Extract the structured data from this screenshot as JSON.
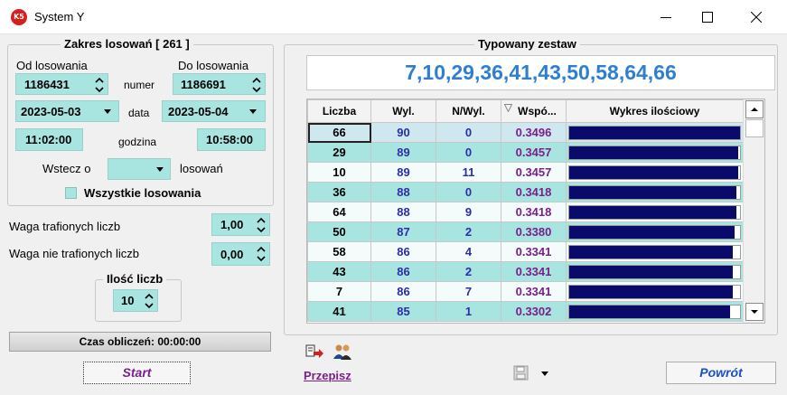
{
  "window": {
    "title": "System Y",
    "icon_text": "K5",
    "minimize_icon": "minimize-icon",
    "maximize_icon": "maximize-icon",
    "close_icon": "close-icon"
  },
  "range": {
    "title": "Zakres losowań  [ 261 ]",
    "from_label": "Od losowania",
    "to_label": "Do losowania",
    "from_number": "1186431",
    "to_number": "1186691",
    "number_label": "numer",
    "from_date": "2023-05-03",
    "to_date": "2023-05-04",
    "date_label": "data",
    "from_time": "11:02:00",
    "to_time": "10:58:00",
    "time_label": "godzina",
    "back_label": "Wstecz o",
    "back_value": "",
    "draws_label": "losowań",
    "all_draws_label": "Wszystkie losowania",
    "all_draws_checked": false
  },
  "weights": {
    "hit_label": "Waga trafionych liczb",
    "hit_value": "1,00",
    "miss_label": "Waga nie trafionych liczb",
    "miss_value": "0,00"
  },
  "count": {
    "title": "Ilość liczb",
    "value": "10"
  },
  "calc_time": "Czas obliczeń: 00:00:00",
  "start_label": "Start",
  "set": {
    "title": "Typowany zestaw",
    "numbers": "7,10,29,36,41,43,50,58,64,66"
  },
  "table": {
    "headers": [
      "Liczba",
      "Wyl.",
      "N/Wyl.",
      "Wspó...",
      "Wykres ilościowy"
    ],
    "rows": [
      {
        "liczba": "66",
        "wyl": "90",
        "nwyl": "0",
        "wsp": "0.3496",
        "fill": 1.0
      },
      {
        "liczba": "29",
        "wyl": "89",
        "nwyl": "0",
        "wsp": "0.3457",
        "fill": 0.989
      },
      {
        "liczba": "10",
        "wyl": "89",
        "nwyl": "11",
        "wsp": "0.3457",
        "fill": 0.989
      },
      {
        "liczba": "36",
        "wyl": "88",
        "nwyl": "0",
        "wsp": "0.3418",
        "fill": 0.978
      },
      {
        "liczba": "64",
        "wyl": "88",
        "nwyl": "9",
        "wsp": "0.3418",
        "fill": 0.978
      },
      {
        "liczba": "50",
        "wyl": "87",
        "nwyl": "2",
        "wsp": "0.3380",
        "fill": 0.967
      },
      {
        "liczba": "58",
        "wyl": "86",
        "nwyl": "4",
        "wsp": "0.3341",
        "fill": 0.956
      },
      {
        "liczba": "43",
        "wyl": "86",
        "nwyl": "2",
        "wsp": "0.3341",
        "fill": 0.956
      },
      {
        "liczba": "7",
        "wyl": "86",
        "nwyl": "7",
        "wsp": "0.3341",
        "fill": 0.956
      },
      {
        "liczba": "41",
        "wyl": "85",
        "nwyl": "1",
        "wsp": "0.3302",
        "fill": 0.944
      }
    ]
  },
  "toolbar": {
    "copy_label": "Przepisz",
    "copy_icon": "copy-to-icon",
    "users_icon": "users-icon",
    "save_icon": "floppy-disk-icon",
    "dropdown_icon": "chevron-down-icon"
  },
  "back_button_label": "Powrót",
  "colors": {
    "cyan": "#a8e4e0",
    "dark_bar": "#0a0a6a",
    "purple": "#7a1f8c",
    "blue": "#2f7fd0"
  }
}
